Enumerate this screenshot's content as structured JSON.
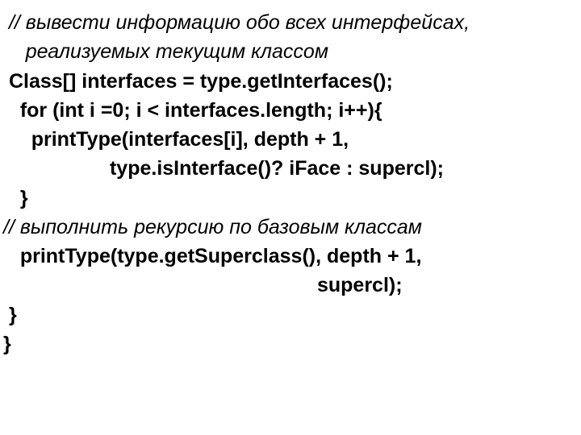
{
  "code": {
    "l1a": " // вывести информацию обо всех интерфейсах,",
    "l1b": "    реализуемых текущим классом",
    "l2": " Class[] interfaces = type.getInterfaces();",
    "l3": "   for (int i =0; i < interfaces.length; i++){",
    "l4": "     printType(interfaces[i], depth + 1,",
    "l5": "                   type.isInterface()? iFace : supercl);",
    "l6": "   }",
    "l7": "// выполнить рекурсию по базовым классам",
    "l8": "   printType(type.getSuperclass(), depth + 1,",
    "l9": "                                                        supercl);",
    "l10": " }",
    "l11": "}"
  }
}
